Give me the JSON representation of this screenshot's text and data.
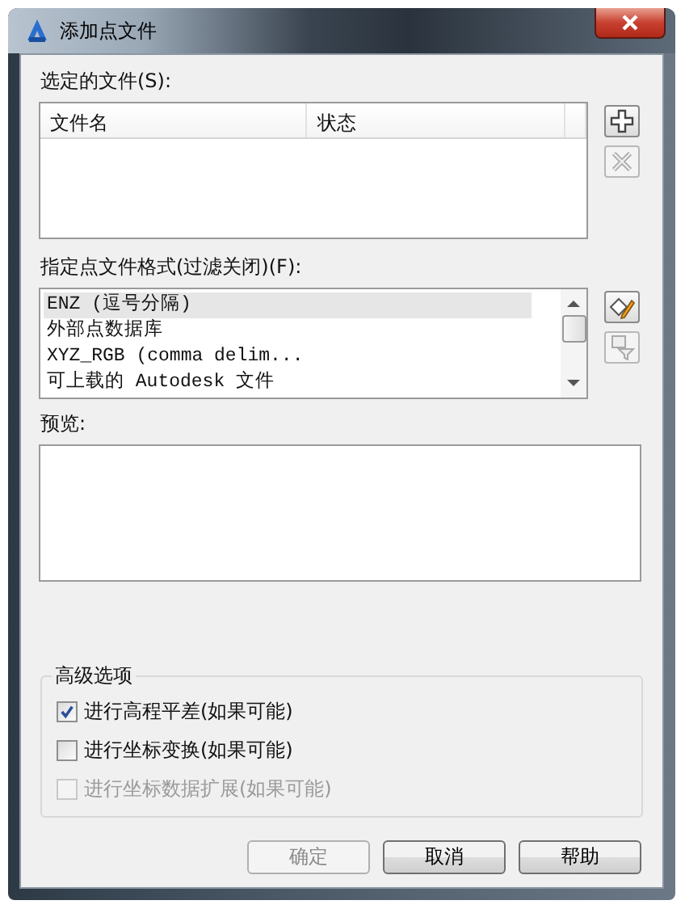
{
  "window": {
    "title": "添加点文件"
  },
  "selected_files": {
    "label": "选定的文件(S):",
    "columns": [
      "文件名",
      "状态"
    ]
  },
  "file_buttons": [
    {
      "kind": "add",
      "disabled": false
    },
    {
      "kind": "remove",
      "disabled": true
    }
  ],
  "formats": {
    "label": "指定点文件格式(过滤关闭)(F):",
    "items": [
      {
        "text": "ENZ (逗号分隔)",
        "selected": true
      },
      {
        "text": "外部点数据库",
        "selected": false
      },
      {
        "text": "XYZ_RGB (comma delim...",
        "selected": false
      },
      {
        "text": "可上载的 Autodesk 文件",
        "selected": false
      }
    ]
  },
  "format_buttons": [
    {
      "kind": "edit",
      "disabled": false
    },
    {
      "kind": "filter",
      "disabled": true
    }
  ],
  "preview": {
    "label": "预览:"
  },
  "advanced": {
    "title": "高级选项",
    "options": [
      {
        "label": "进行高程平差(如果可能)",
        "checked": true,
        "disabled": false
      },
      {
        "label": "进行坐标变换(如果可能)",
        "checked": false,
        "disabled": false
      },
      {
        "label": "进行坐标数据扩展(如果可能)",
        "checked": false,
        "disabled": true
      }
    ]
  },
  "buttons": [
    {
      "label": "确定",
      "disabled": true
    },
    {
      "label": "取消",
      "disabled": false
    },
    {
      "label": "帮助",
      "disabled": false
    }
  ]
}
